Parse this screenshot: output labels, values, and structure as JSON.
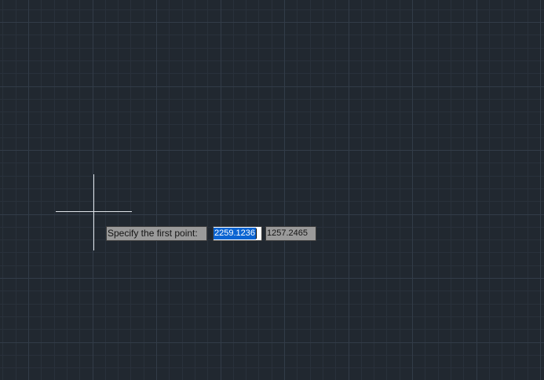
{
  "drawing_area": {
    "background_color": "#212830",
    "grid_minor_color": "#29313b",
    "grid_major_color": "#323c48"
  },
  "cursor": {
    "icon": "crosshair-cursor-icon",
    "color": "#dfe3e8"
  },
  "dynamic_input": {
    "prompt": "Specify the first point:",
    "x_value": "2259.1236",
    "y_value": "1257.2465",
    "selection_color": "#0a64d2"
  }
}
